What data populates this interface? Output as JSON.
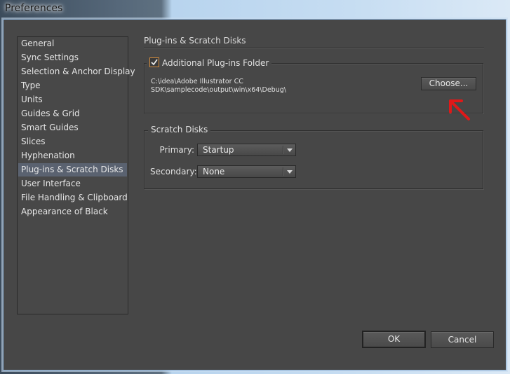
{
  "window": {
    "title": "Preferences"
  },
  "sidebar": {
    "items": [
      {
        "label": "General"
      },
      {
        "label": "Sync Settings"
      },
      {
        "label": "Selection & Anchor Display"
      },
      {
        "label": "Type"
      },
      {
        "label": "Units"
      },
      {
        "label": "Guides & Grid"
      },
      {
        "label": "Smart Guides"
      },
      {
        "label": "Slices"
      },
      {
        "label": "Hyphenation"
      },
      {
        "label": "Plug-ins & Scratch Disks",
        "selected": true
      },
      {
        "label": "User Interface"
      },
      {
        "label": "File Handling & Clipboard"
      },
      {
        "label": "Appearance of Black"
      }
    ]
  },
  "main": {
    "section_title": "Plug-ins & Scratch Disks",
    "plugins": {
      "checkbox_label": "Additional Plug-ins Folder",
      "checked": true,
      "path_line1": "C:\\idea\\Adobe Illustrator CC",
      "path_line2": "SDK\\samplecode\\output\\win\\x64\\Debug\\",
      "choose_label": "Choose..."
    },
    "scratch": {
      "legend": "Scratch Disks",
      "primary_label": "Primary:",
      "primary_value": "Startup",
      "secondary_label": "Secondary:",
      "secondary_value": "None"
    }
  },
  "footer": {
    "ok_label": "OK",
    "cancel_label": "Cancel"
  },
  "annotation": {
    "arrow_color": "#e01818"
  }
}
